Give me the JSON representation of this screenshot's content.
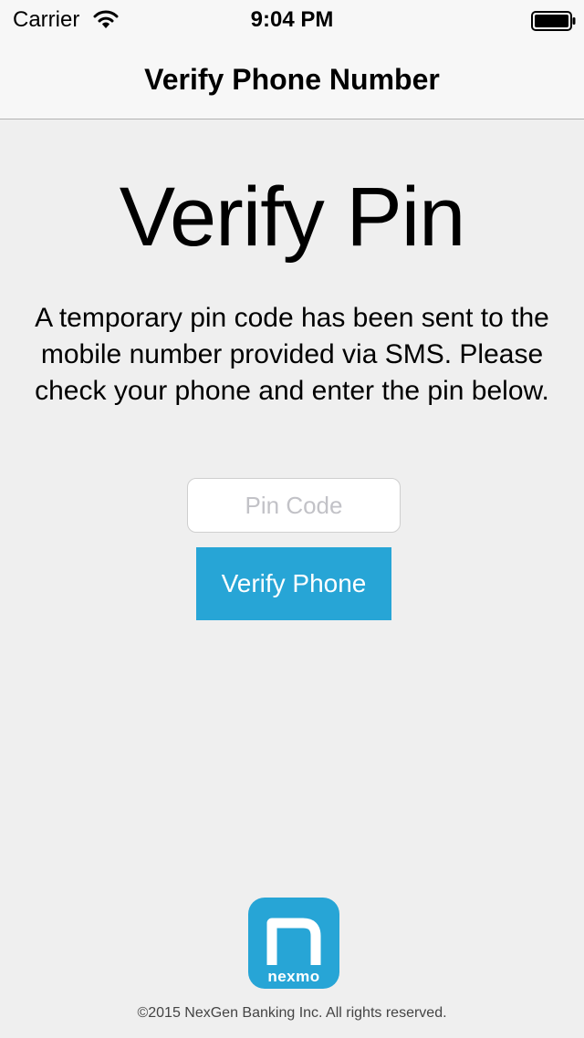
{
  "status_bar": {
    "carrier": "Carrier",
    "time": "9:04 PM",
    "icons": [
      "wifi-icon",
      "battery-icon"
    ]
  },
  "nav": {
    "title": "Verify Phone Number"
  },
  "main": {
    "heading": "Verify Pin",
    "description": "A temporary pin code has been sent to the mobile number provided via SMS. Please check your phone and enter the pin below.",
    "pin_input": {
      "placeholder": "Pin Code",
      "value": ""
    },
    "verify_button_label": "Verify Phone"
  },
  "footer": {
    "logo_text": "nexmo",
    "copyright": "©2015 NexGen Banking Inc. All rights reserved."
  },
  "colors": {
    "accent": "#27a5d6",
    "background": "#efefef",
    "nav_background": "#f7f7f7"
  }
}
